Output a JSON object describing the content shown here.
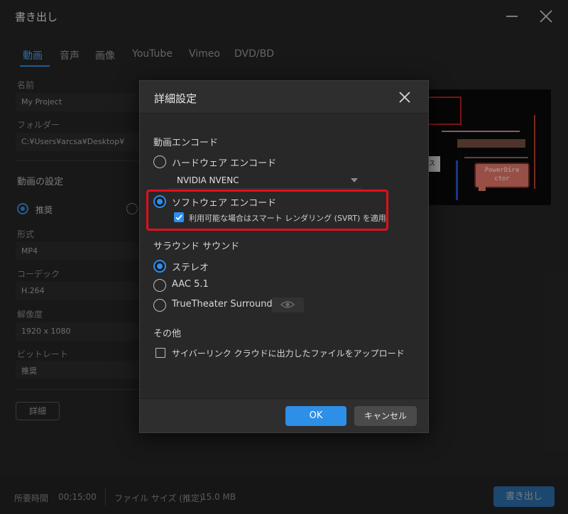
{
  "window": {
    "title": "書き出し",
    "tabs": [
      "動画",
      "音声",
      "画像",
      "YouTube",
      "Vimeo",
      "DVD/BD"
    ],
    "active_tab": "動画"
  },
  "form": {
    "name_label": "名前",
    "name_value": "My Project",
    "folder_label": "フォルダー",
    "folder_value": "C:¥Users¥arcsa¥Desktop¥",
    "video_settings_title": "動画の設定",
    "recommended_label": "推奨",
    "format_label": "形式",
    "format_value": "MP4",
    "codec_label": "コーデック",
    "codec_value": "H.264",
    "resolution_label": "解像度",
    "resolution_value": "1920 x 1080",
    "bitrate_label": "ビットレート",
    "bitrate_value": "推奨",
    "details_button": "詳細"
  },
  "preview": {
    "bubble_line1": "PowerDire",
    "bubble_line2": "ctor",
    "sign_fragment": "ス"
  },
  "footer": {
    "time_label": "所要時間",
    "time_value": "00;15;00",
    "size_label": "ファイル サイズ (推定)",
    "size_value": "15.0 MB",
    "export_button": "書き出し"
  },
  "dialog": {
    "title": "詳細設定",
    "video_encode_title": "動画エンコード",
    "hardware_encode": "ハードウェア エンコード",
    "hardware_device": "NVIDIA NVENC",
    "software_encode": "ソフトウェア エンコード",
    "svrt_option": "利用可能な場合はスマート レンダリング (SVRT) を適用",
    "svrt_checked": true,
    "selected_encode": "software",
    "surround_title": "サラウンド サウンド",
    "stereo": "ステレオ",
    "aac": "AAC 5.1",
    "truetheater": "TrueTheater Surround",
    "selected_surround": "stereo",
    "other_title": "その他",
    "cyberlink_upload": "サイバーリンク クラウドに出力したファイルをアップロード",
    "cyberlink_upload_checked": false,
    "ok_button": "OK",
    "cancel_button": "キャンセル"
  },
  "colors": {
    "accent": "#2e8fe6",
    "highlight_border": "#e0101e"
  }
}
